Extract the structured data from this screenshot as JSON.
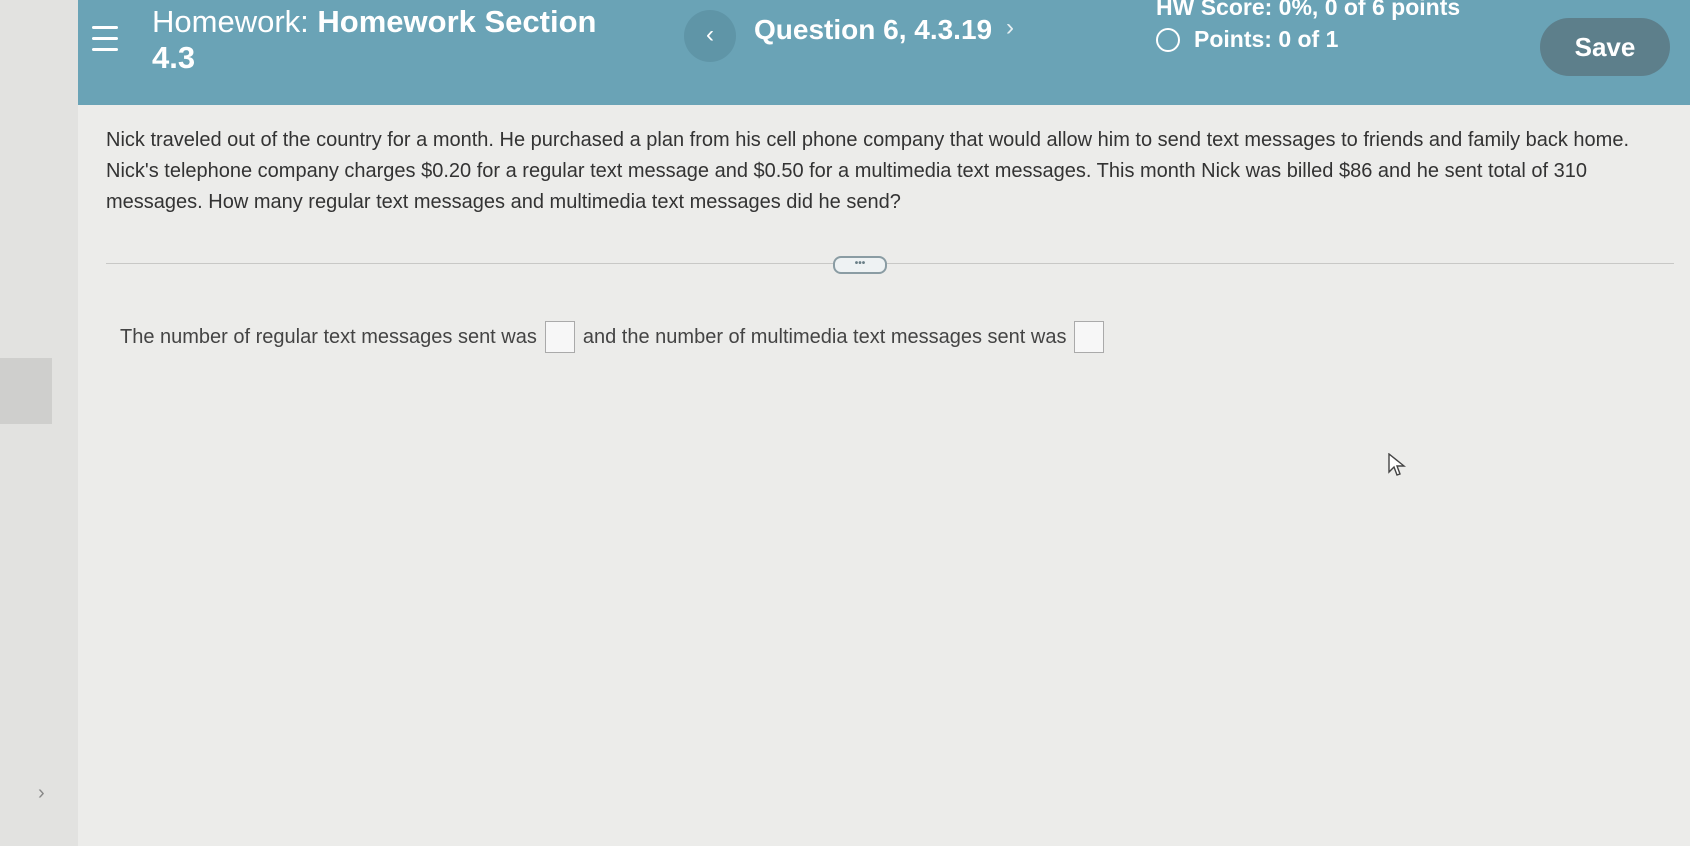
{
  "header": {
    "title_prefix": "Homework:",
    "title_name": "Homework Section 4.3",
    "prev_label": "‹",
    "question_title": "Question 6, 4.3.19",
    "next_label": "›",
    "hw_score": "HW Score: 0%, 0 of 6 points",
    "points": "Points: 0 of 1",
    "save_label": "Save"
  },
  "question": {
    "text": "Nick traveled out of the country for a month. He purchased a plan from his cell phone company that would allow him to send text messages to friends and family back home. Nick's telephone company charges $0.20 for a regular text message and $0.50 for a multimedia text messages. This month Nick was billed $86 and he sent total of 310 messages. How many regular text messages and multimedia text messages did he send?",
    "more_label": "•••"
  },
  "answer": {
    "part1": "The number of regular text messages sent was",
    "part2": "and the number of multimedia text messages sent was",
    "regular_value": "",
    "multimedia_value": ""
  },
  "rail": {
    "chevron": "›"
  },
  "colors": {
    "header_bg": "#6aa3b6",
    "save_bg": "#5d7f8b"
  }
}
